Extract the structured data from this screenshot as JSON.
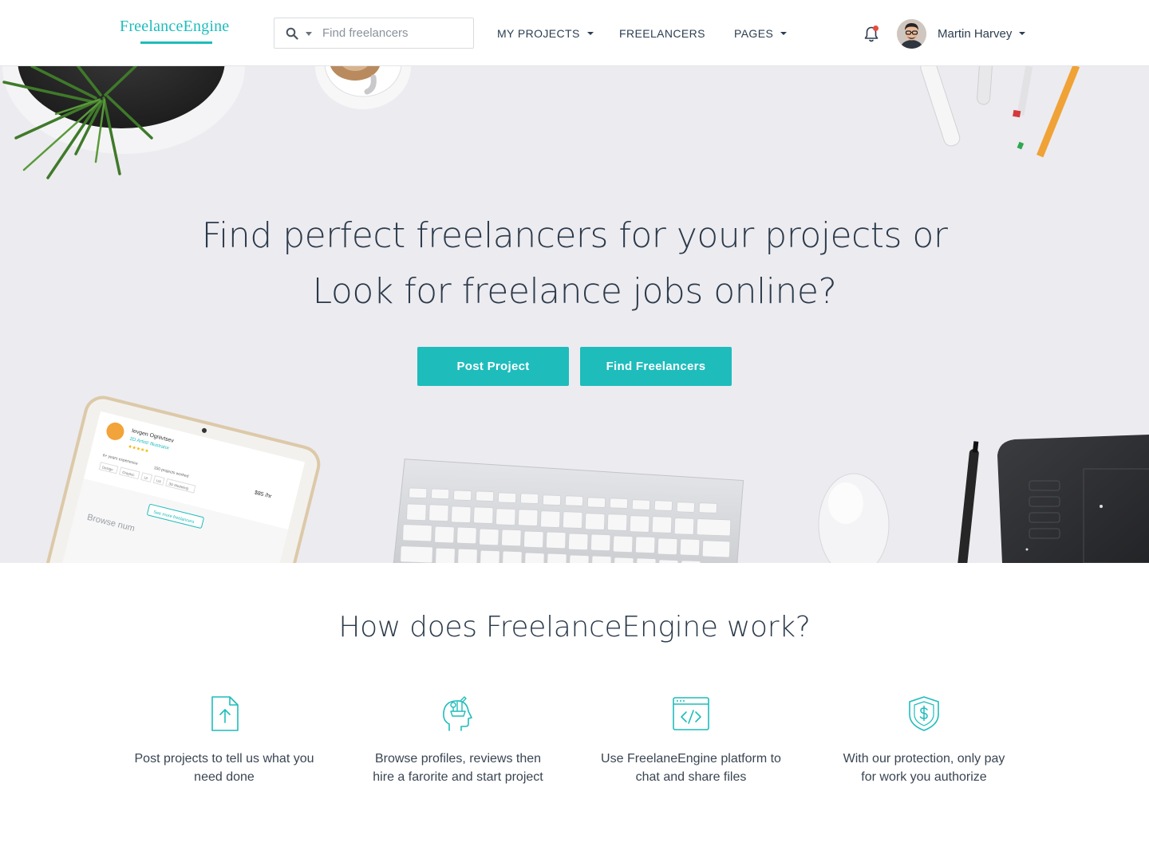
{
  "nav": {
    "logo": "FreelanceEngine",
    "search_placeholder": "Find freelancers",
    "items": [
      {
        "label": "MY PROJECTS",
        "has_dropdown": true
      },
      {
        "label": "FREELANCERS",
        "has_dropdown": false
      },
      {
        "label": "PAGES",
        "has_dropdown": true
      }
    ],
    "user_name": "Martin Harvey",
    "notification_dot_color": "#e74c3c"
  },
  "hero": {
    "title_line1": "Find perfect freelancers for your projects or",
    "title_line2": "Look for freelance jobs online?",
    "buttons": {
      "post_project": "Post Project",
      "find_freelancers": "Find Freelancers"
    },
    "tablet_card": {
      "name": "Ievgen Ognivtsev",
      "role": "2D Artist/ Illustrator",
      "experience": "6+ years experience",
      "projects": "150 projects worked",
      "rate": "$85",
      "rate_unit": "/hr",
      "tags": [
        "Design",
        "Graphic",
        "UI",
        "UX",
        "3D Modeling"
      ],
      "see_more": "See more freelancers",
      "browse": "Browse num"
    }
  },
  "how": {
    "title": "How does FreelanceEngine work?",
    "steps": [
      {
        "icon": "upload-document-icon",
        "text_line1": "Post projects to tell us what you",
        "text_line2": "need done"
      },
      {
        "icon": "creative-head-icon",
        "text_line1": "Browse profiles, reviews then",
        "text_line2": "hire a farorite and start project"
      },
      {
        "icon": "code-window-icon",
        "text_line1": "Use FreelaneEngine platform to",
        "text_line2": "chat and share files"
      },
      {
        "icon": "shield-dollar-icon",
        "text_line1": "With our protection, only pay",
        "text_line2": "for work you authorize"
      }
    ]
  },
  "colors": {
    "accent": "#1fbcbc",
    "hero_bg": "#ecebf0",
    "text": "#2b3a4a"
  }
}
